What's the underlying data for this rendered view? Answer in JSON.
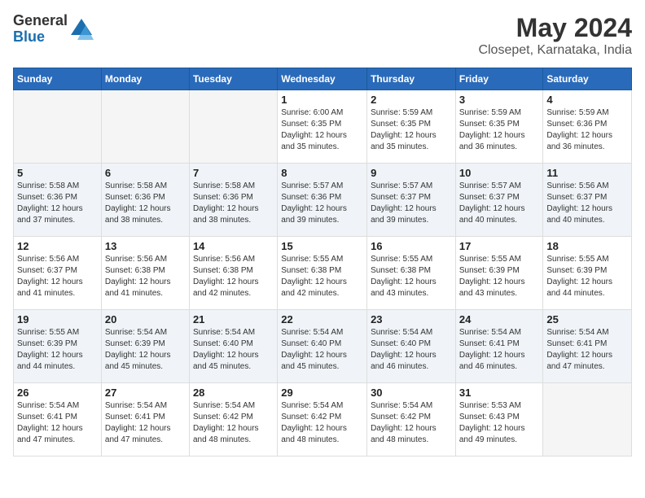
{
  "logo": {
    "general": "General",
    "blue": "Blue"
  },
  "title": "May 2024",
  "subtitle": "Closepet, Karnataka, India",
  "days_of_week": [
    "Sunday",
    "Monday",
    "Tuesday",
    "Wednesday",
    "Thursday",
    "Friday",
    "Saturday"
  ],
  "weeks": [
    [
      {
        "day": "",
        "info": ""
      },
      {
        "day": "",
        "info": ""
      },
      {
        "day": "",
        "info": ""
      },
      {
        "day": "1",
        "info": "Sunrise: 6:00 AM\nSunset: 6:35 PM\nDaylight: 12 hours\nand 35 minutes."
      },
      {
        "day": "2",
        "info": "Sunrise: 5:59 AM\nSunset: 6:35 PM\nDaylight: 12 hours\nand 35 minutes."
      },
      {
        "day": "3",
        "info": "Sunrise: 5:59 AM\nSunset: 6:35 PM\nDaylight: 12 hours\nand 36 minutes."
      },
      {
        "day": "4",
        "info": "Sunrise: 5:59 AM\nSunset: 6:36 PM\nDaylight: 12 hours\nand 36 minutes."
      }
    ],
    [
      {
        "day": "5",
        "info": "Sunrise: 5:58 AM\nSunset: 6:36 PM\nDaylight: 12 hours\nand 37 minutes."
      },
      {
        "day": "6",
        "info": "Sunrise: 5:58 AM\nSunset: 6:36 PM\nDaylight: 12 hours\nand 38 minutes."
      },
      {
        "day": "7",
        "info": "Sunrise: 5:58 AM\nSunset: 6:36 PM\nDaylight: 12 hours\nand 38 minutes."
      },
      {
        "day": "8",
        "info": "Sunrise: 5:57 AM\nSunset: 6:36 PM\nDaylight: 12 hours\nand 39 minutes."
      },
      {
        "day": "9",
        "info": "Sunrise: 5:57 AM\nSunset: 6:37 PM\nDaylight: 12 hours\nand 39 minutes."
      },
      {
        "day": "10",
        "info": "Sunrise: 5:57 AM\nSunset: 6:37 PM\nDaylight: 12 hours\nand 40 minutes."
      },
      {
        "day": "11",
        "info": "Sunrise: 5:56 AM\nSunset: 6:37 PM\nDaylight: 12 hours\nand 40 minutes."
      }
    ],
    [
      {
        "day": "12",
        "info": "Sunrise: 5:56 AM\nSunset: 6:37 PM\nDaylight: 12 hours\nand 41 minutes."
      },
      {
        "day": "13",
        "info": "Sunrise: 5:56 AM\nSunset: 6:38 PM\nDaylight: 12 hours\nand 41 minutes."
      },
      {
        "day": "14",
        "info": "Sunrise: 5:56 AM\nSunset: 6:38 PM\nDaylight: 12 hours\nand 42 minutes."
      },
      {
        "day": "15",
        "info": "Sunrise: 5:55 AM\nSunset: 6:38 PM\nDaylight: 12 hours\nand 42 minutes."
      },
      {
        "day": "16",
        "info": "Sunrise: 5:55 AM\nSunset: 6:38 PM\nDaylight: 12 hours\nand 43 minutes."
      },
      {
        "day": "17",
        "info": "Sunrise: 5:55 AM\nSunset: 6:39 PM\nDaylight: 12 hours\nand 43 minutes."
      },
      {
        "day": "18",
        "info": "Sunrise: 5:55 AM\nSunset: 6:39 PM\nDaylight: 12 hours\nand 44 minutes."
      }
    ],
    [
      {
        "day": "19",
        "info": "Sunrise: 5:55 AM\nSunset: 6:39 PM\nDaylight: 12 hours\nand 44 minutes."
      },
      {
        "day": "20",
        "info": "Sunrise: 5:54 AM\nSunset: 6:39 PM\nDaylight: 12 hours\nand 45 minutes."
      },
      {
        "day": "21",
        "info": "Sunrise: 5:54 AM\nSunset: 6:40 PM\nDaylight: 12 hours\nand 45 minutes."
      },
      {
        "day": "22",
        "info": "Sunrise: 5:54 AM\nSunset: 6:40 PM\nDaylight: 12 hours\nand 45 minutes."
      },
      {
        "day": "23",
        "info": "Sunrise: 5:54 AM\nSunset: 6:40 PM\nDaylight: 12 hours\nand 46 minutes."
      },
      {
        "day": "24",
        "info": "Sunrise: 5:54 AM\nSunset: 6:41 PM\nDaylight: 12 hours\nand 46 minutes."
      },
      {
        "day": "25",
        "info": "Sunrise: 5:54 AM\nSunset: 6:41 PM\nDaylight: 12 hours\nand 47 minutes."
      }
    ],
    [
      {
        "day": "26",
        "info": "Sunrise: 5:54 AM\nSunset: 6:41 PM\nDaylight: 12 hours\nand 47 minutes."
      },
      {
        "day": "27",
        "info": "Sunrise: 5:54 AM\nSunset: 6:41 PM\nDaylight: 12 hours\nand 47 minutes."
      },
      {
        "day": "28",
        "info": "Sunrise: 5:54 AM\nSunset: 6:42 PM\nDaylight: 12 hours\nand 48 minutes."
      },
      {
        "day": "29",
        "info": "Sunrise: 5:54 AM\nSunset: 6:42 PM\nDaylight: 12 hours\nand 48 minutes."
      },
      {
        "day": "30",
        "info": "Sunrise: 5:54 AM\nSunset: 6:42 PM\nDaylight: 12 hours\nand 48 minutes."
      },
      {
        "day": "31",
        "info": "Sunrise: 5:53 AM\nSunset: 6:43 PM\nDaylight: 12 hours\nand 49 minutes."
      },
      {
        "day": "",
        "info": ""
      }
    ]
  ]
}
